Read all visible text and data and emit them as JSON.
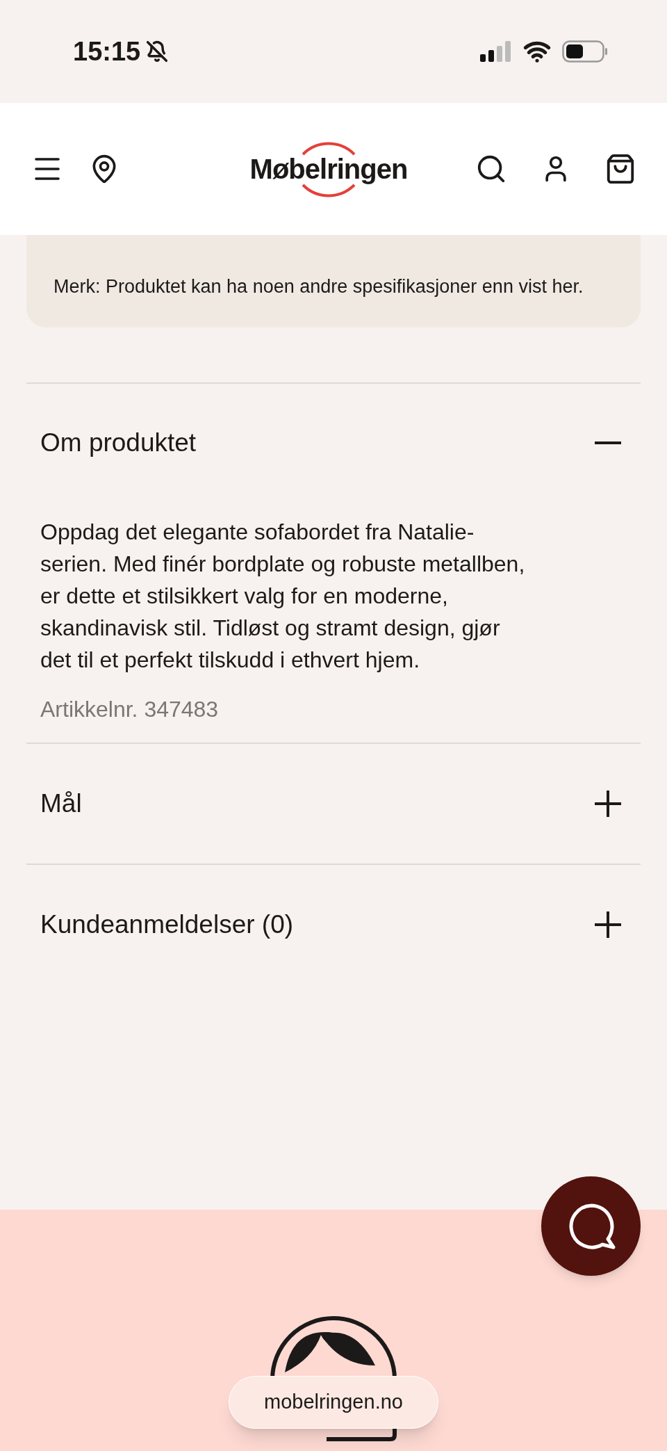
{
  "status_bar": {
    "time": "15:15"
  },
  "header": {
    "logo": "Møbelringen"
  },
  "note": {
    "text": "Merk: Produktet kan ha noen andre spesifikasjoner enn vist her."
  },
  "sections": [
    {
      "title": "Om produktet",
      "expanded": true,
      "description": "Oppdag det elegante sofabordet fra Natalie-serien. Med finér bordplate og robuste metallben, er dette et stilsikkert valg for en moderne, skandinavisk stil. Tidløst og stramt design, gjør det til et perfekt tilskudd i ethvert hjem.",
      "article_number": "Artikkelnr. 347483"
    },
    {
      "title": "Mål",
      "expanded": false
    },
    {
      "title": "Kundeanmeldelser (0)",
      "expanded": false
    }
  ],
  "url_bar": {
    "url": "mobelringen.no"
  }
}
